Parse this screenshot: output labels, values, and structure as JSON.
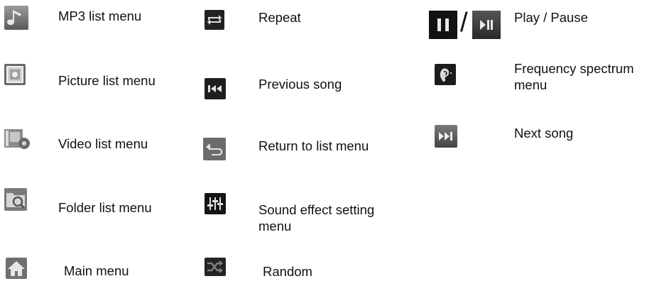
{
  "columns": [
    {
      "items": [
        {
          "icon": "music-note-icon",
          "label": "MP3 list menu"
        },
        {
          "icon": "picture-icon",
          "label": "Picture list menu"
        },
        {
          "icon": "video-icon",
          "label": "Video list menu"
        },
        {
          "icon": "folder-search-icon",
          "label": "Folder list menu"
        },
        {
          "icon": "home-icon",
          "label": "Main menu"
        }
      ]
    },
    {
      "items": [
        {
          "icon": "repeat-icon",
          "label": "Repeat"
        },
        {
          "icon": "previous-track-icon",
          "label": "Previous song"
        },
        {
          "icon": "return-icon",
          "label": "Return to list menu"
        },
        {
          "icon": "equalizer-icon",
          "label_line1": "Sound effect setting",
          "label_line2": "menu"
        },
        {
          "icon": "shuffle-icon",
          "label": "Random"
        }
      ]
    },
    {
      "items": [
        {
          "icon": "pause-icon",
          "icon2": "play-pause-icon",
          "separator": "/",
          "label": "Play / Pause"
        },
        {
          "icon": "ear-icon",
          "label_line1": "Frequency spectrum",
          "label_line2": "menu"
        },
        {
          "icon": "next-track-icon",
          "label": "Next song"
        }
      ]
    }
  ]
}
